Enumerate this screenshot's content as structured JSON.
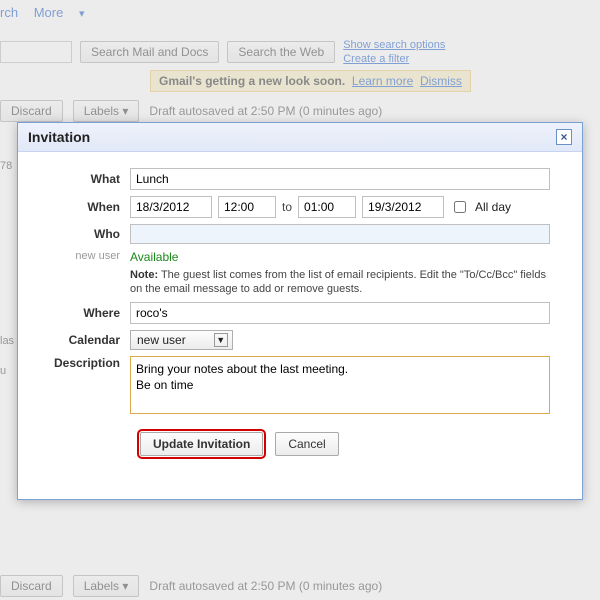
{
  "topNav": {
    "item1": "rch",
    "item2": "More",
    "dropdown": "▾"
  },
  "search": {
    "btnMailDocs": "Search Mail and Docs",
    "btnWeb": "Search the Web",
    "linkOptions": "Show search options",
    "linkFilter": "Create a filter"
  },
  "banner": {
    "text": "Gmail's getting a new look soon.",
    "learn": "Learn more",
    "dismiss": "Dismiss"
  },
  "toolbar": {
    "discard": "Discard",
    "labels": "Labels ▾",
    "autosave": "Draft autosaved at 2:50 PM (0 minutes ago)"
  },
  "sidebar": {
    "frag1": "78",
    "frag2": "las",
    "frag3": "u"
  },
  "modal": {
    "title": "Invitation",
    "close": "×",
    "labels": {
      "what": "What",
      "when": "When",
      "who": "Who",
      "newUser": "new user",
      "where": "Where",
      "calendar": "Calendar",
      "description": "Description",
      "to": "to",
      "allDay": "All day"
    },
    "fields": {
      "what": "Lunch",
      "dateStart": "18/3/2012",
      "timeStart": "12:00",
      "timeEnd": "01:00",
      "dateEnd": "19/3/2012",
      "available": "Available",
      "noteBold": "Note:",
      "noteText": " The guest list comes from the list of email recipients. Edit the \"To/Cc/Bcc\" fields on the email message to add or remove guests.",
      "where": "roco's",
      "calendar": "new user",
      "description": "Bring your notes about the last meeting.\nBe on time"
    },
    "buttons": {
      "update": "Update Invitation",
      "cancel": "Cancel"
    }
  }
}
